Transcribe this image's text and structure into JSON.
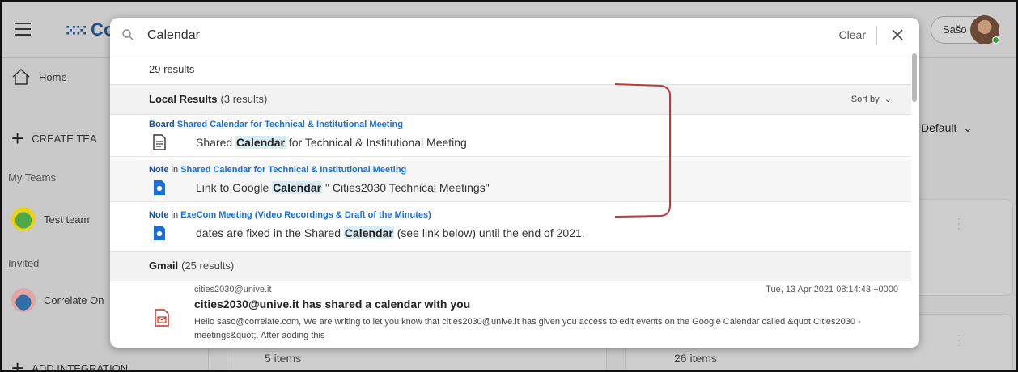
{
  "app": {
    "logo_text": "Co"
  },
  "user": {
    "name": "Sašo"
  },
  "sidebar": {
    "home": "Home",
    "create_team": "CREATE TEA",
    "my_teams": "My Teams",
    "test_team": "Test team",
    "invited": "Invited",
    "correlate": "Correlate On",
    "add_integration": "ADD INTEGRATION"
  },
  "background": {
    "default_sort": "Default",
    "card1_items": "5 items",
    "card2_items": "26 items"
  },
  "search": {
    "query": "Calendar",
    "clear_label": "Clear",
    "result_count": "29 results"
  },
  "local": {
    "title": "Local Results",
    "count": "(3 results)",
    "sort_by": "Sort by",
    "results": [
      {
        "type": "Board",
        "in": "",
        "parent": "Shared Calendar for Technical & Institutional Meeting",
        "text_before": "Shared ",
        "highlight": "Calendar",
        "text_after": " for Technical & Institutional Meeting",
        "icon": "document-icon"
      },
      {
        "type": "Note",
        "in": "in",
        "parent": "Shared Calendar for Technical & Institutional Meeting",
        "text_before": "Link to Google ",
        "highlight": "Calendar",
        "text_after": " \" Cities2030 Technical Meetings\"",
        "icon": "note-icon"
      },
      {
        "type": "Note",
        "in": "in",
        "parent": "ExeCom Meeting (Video Recordings & Draft of the Minutes)",
        "text_before": "dates are fixed in the Shared ",
        "highlight": "Calendar",
        "text_after": " (see link below) until the end of 2021.",
        "icon": "note-icon"
      }
    ]
  },
  "gmail": {
    "title": "Gmail",
    "count": "(25 results)",
    "item": {
      "from": "cities2030@unive.it",
      "date": "Tue, 13 Apr 2021 08:14:43 +0000",
      "subject": "cities2030@unive.it has shared a calendar with you",
      "snippet": "Hello saso@correlate.com, We are writing to let you know that cities2030@unive.it has given you access to edit events on the Google Calendar called &quot;Cities2030 - meetings&quot;. After adding this"
    }
  },
  "colors": {
    "link_blue": "#1a6ed8",
    "highlight_bg": "#d9ecf4",
    "annotation_red": "#b83a3a",
    "gmail_icon_red": "#c0392b"
  }
}
